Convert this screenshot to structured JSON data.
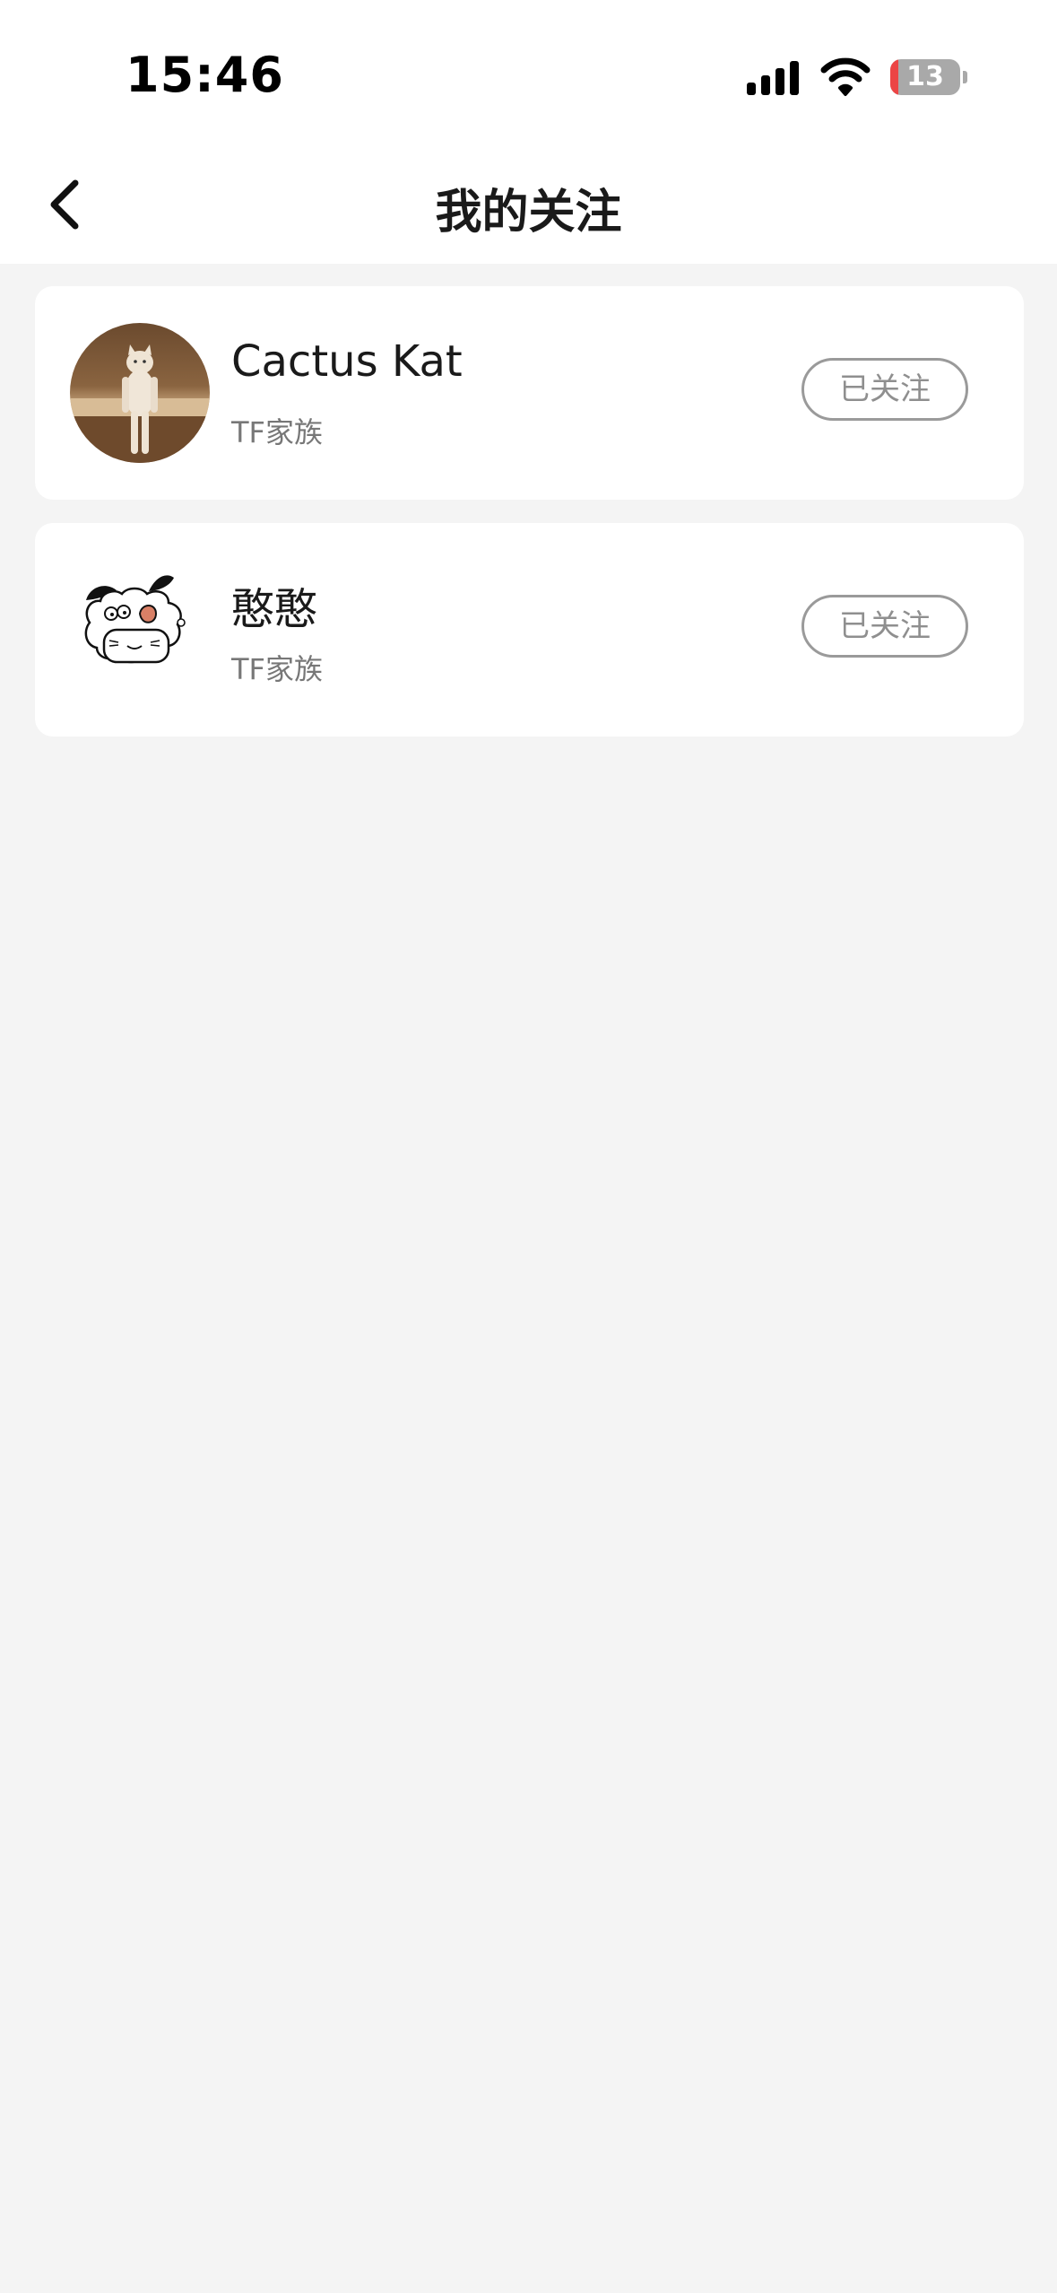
{
  "status_bar": {
    "time": "15:46",
    "battery_level": "13",
    "icons": [
      "signal-icon",
      "wifi-icon",
      "battery-icon"
    ]
  },
  "nav": {
    "title": "我的关注",
    "back_icon": "chevron-left-icon"
  },
  "following": [
    {
      "name": "Cactus Kat",
      "group": "TF家族",
      "button_label": "已关注",
      "avatar": "cat-photo-avatar"
    },
    {
      "name": "憨憨",
      "group": "TF家族",
      "button_label": "已关注",
      "avatar": "cartoon-bunny-avatar"
    }
  ],
  "colors": {
    "page_background": "#f4f4f4",
    "card_background": "#ffffff",
    "button_border": "#9a9a9a",
    "battery_low": "#ec4545"
  }
}
